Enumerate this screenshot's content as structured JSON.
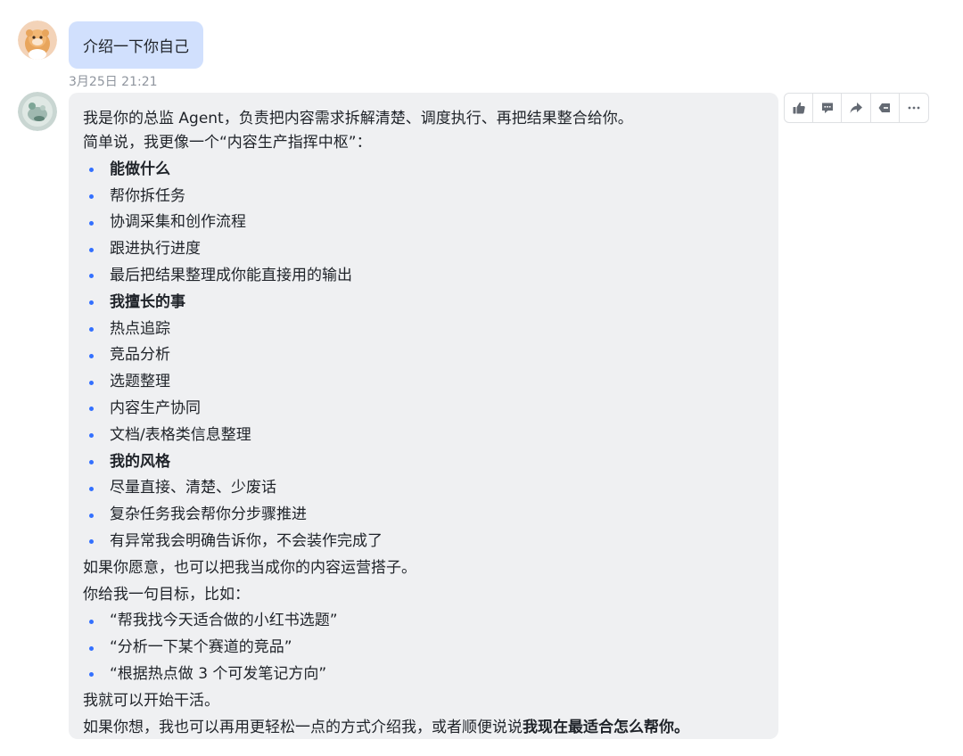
{
  "conversation": {
    "user_message": {
      "text": "介绍一下你自己",
      "timestamp": "3月25日 21:21"
    },
    "bot_message": {
      "lines": [
        {
          "type": "text",
          "text": "我是你的总监 Agent，负责把内容需求拆解清楚、调度执行、再把结果整合给你。"
        },
        {
          "type": "text",
          "text": "简单说，我更像一个“内容生产指挥中枢”："
        },
        {
          "type": "bullet",
          "bold": true,
          "text": "能做什么"
        },
        {
          "type": "bullet",
          "text": "帮你拆任务"
        },
        {
          "type": "bullet",
          "text": "协调采集和创作流程"
        },
        {
          "type": "bullet",
          "text": "跟进执行进度"
        },
        {
          "type": "bullet",
          "text": "最后把结果整理成你能直接用的输出"
        },
        {
          "type": "bullet",
          "bold": true,
          "text": "我擅长的事"
        },
        {
          "type": "bullet",
          "text": "热点追踪"
        },
        {
          "type": "bullet",
          "text": "竞品分析"
        },
        {
          "type": "bullet",
          "text": "选题整理"
        },
        {
          "type": "bullet",
          "text": "内容生产协同"
        },
        {
          "type": "bullet",
          "text": "文档/表格类信息整理"
        },
        {
          "type": "bullet",
          "bold": true,
          "text": "我的风格"
        },
        {
          "type": "bullet",
          "text": "尽量直接、清楚、少废话"
        },
        {
          "type": "bullet",
          "text": "复杂任务我会帮你分步骤推进"
        },
        {
          "type": "bullet",
          "text": "有异常我会明确告诉你，不会装作完成了"
        },
        {
          "type": "text",
          "text": "如果你愿意，也可以把我当成你的内容运营搭子。"
        },
        {
          "type": "text",
          "text": "你给我一句目标，比如："
        },
        {
          "type": "bullet",
          "text": "“帮我找今天适合做的小红书选题”"
        },
        {
          "type": "bullet",
          "text": "“分析一下某个赛道的竞品”"
        },
        {
          "type": "bullet",
          "text": "“根据热点做 3 个可发笔记方向”"
        },
        {
          "type": "text",
          "text": "我就可以开始干活。"
        },
        {
          "type": "mixed",
          "text": "如果你想，我也可以再用更轻松一点的方式介绍我，或者顺便说说",
          "bold_text": "我现在最适合怎么帮你。"
        }
      ]
    },
    "toolbar": {
      "actions": [
        {
          "name": "like-icon"
        },
        {
          "name": "comment-icon"
        },
        {
          "name": "forward-icon"
        },
        {
          "name": "delete-message-icon"
        },
        {
          "name": "more-icon"
        }
      ]
    },
    "colors": {
      "user_bubble": "#d1e0fd",
      "bot_bubble": "#eff0f2",
      "bullet": "#3370ff",
      "timestamp": "#8f959e"
    }
  }
}
